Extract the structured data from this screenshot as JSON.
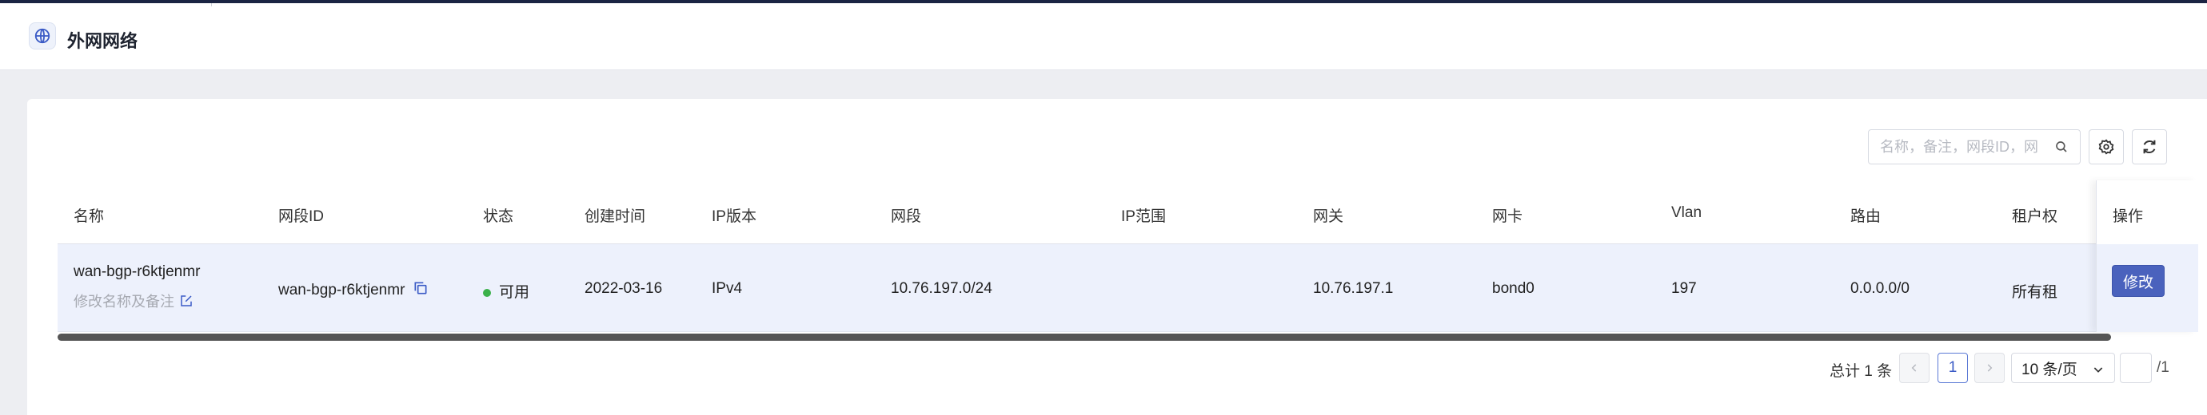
{
  "header": {
    "title": "外网网络"
  },
  "toolbar": {
    "search_placeholder": "名称，备注，网段ID，网"
  },
  "table": {
    "columns": [
      "名称",
      "网段ID",
      "状态",
      "创建时间",
      "IP版本",
      "网段",
      "IP范围",
      "网关",
      "网卡",
      "Vlan",
      "路由",
      "租户权"
    ],
    "action_column": "操作",
    "rows": [
      {
        "name": "wan-bgp-r6ktjenmr",
        "name_edit": "修改名称及备注",
        "segment_id": "wan-bgp-r6ktjenmr",
        "status": "可用",
        "created": "2022-03-16",
        "ip_version": "IPv4",
        "segment": "10.76.197.0/24",
        "ip_range": "",
        "gateway": "10.76.197.1",
        "nic": "bond0",
        "vlan": "197",
        "route": "0.0.0.0/0",
        "tenant": "所有租",
        "action": "修改"
      }
    ]
  },
  "pagination": {
    "total": "总计 1 条",
    "current_page": "1",
    "page_size": "10 条/页",
    "total_pages": "/1"
  },
  "colors": {
    "accent": "#4a62bd",
    "status_ok": "#3bb14a",
    "row_highlight": "#edf1fc"
  }
}
